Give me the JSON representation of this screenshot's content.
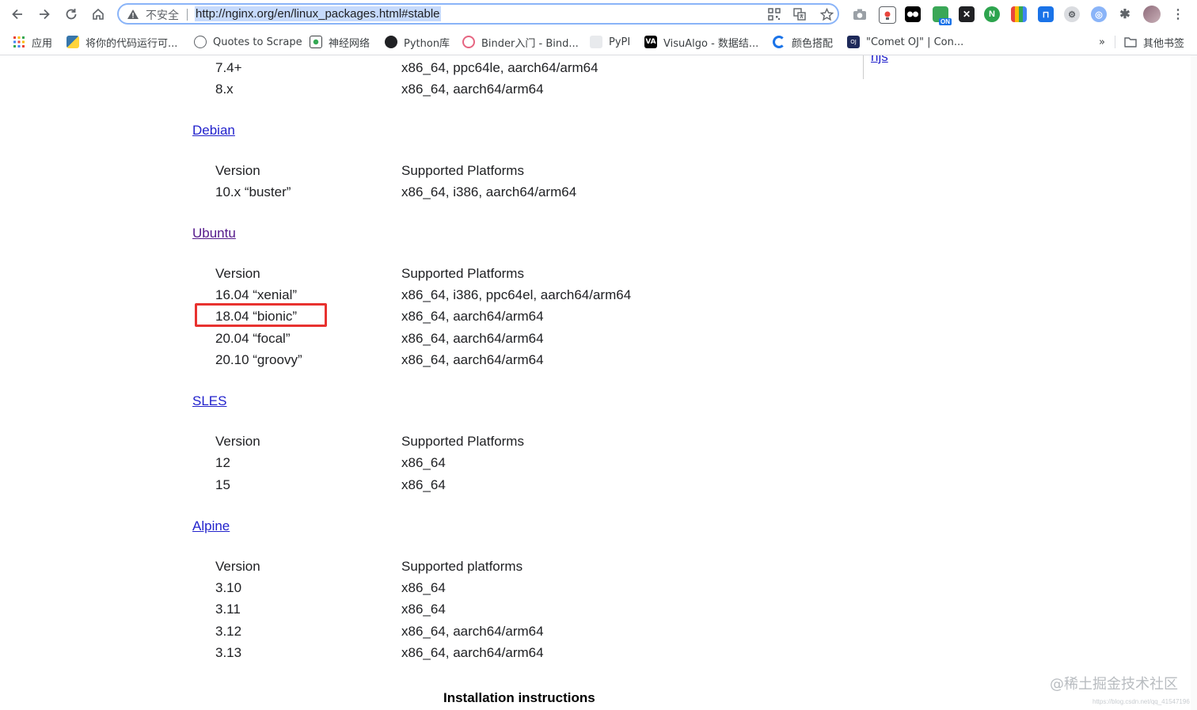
{
  "browser": {
    "insecure_label": "不安全",
    "url": "http://nginx.org/en/linux_packages.html#stable"
  },
  "bookmarks": [
    {
      "label": "应用"
    },
    {
      "label": "将你的代码运行可..."
    },
    {
      "label": "Quotes to Scrape"
    },
    {
      "label": "神经网络"
    },
    {
      "label": "Python库"
    },
    {
      "label": "Binder入门 - Bind..."
    },
    {
      "label": "PyPI"
    },
    {
      "label": "VisuAlgo - 数据结..."
    },
    {
      "label": "颜色搭配"
    },
    {
      "label": "\"Comet OJ\" | Con..."
    }
  ],
  "bookmarks_overflow": "»",
  "other_bookmarks": "其他书签",
  "sidebar": {
    "link": "njs"
  },
  "sections": {
    "top_rows": [
      {
        "version": "7.4+",
        "platforms": "x86_64, ppc64le, aarch64/arm64"
      },
      {
        "version": "8.x",
        "platforms": "x86_64, aarch64/arm64"
      }
    ],
    "debian": {
      "title": "Debian",
      "header": {
        "version": "Version",
        "platforms": "Supported Platforms"
      },
      "rows": [
        {
          "version": "10.x “buster”",
          "platforms": "x86_64, i386, aarch64/arm64"
        }
      ]
    },
    "ubuntu": {
      "title": "Ubuntu",
      "header": {
        "version": "Version",
        "platforms": "Supported Platforms"
      },
      "rows": [
        {
          "version": "16.04 “xenial”",
          "platforms": "x86_64, i386, ppc64el, aarch64/arm64"
        },
        {
          "version": "18.04 “bionic”",
          "platforms": "x86_64, aarch64/arm64"
        },
        {
          "version": "20.04 “focal”",
          "platforms": "x86_64, aarch64/arm64"
        },
        {
          "version": "20.10 “groovy”",
          "platforms": "x86_64, aarch64/arm64"
        }
      ]
    },
    "sles": {
      "title": "SLES",
      "header": {
        "version": "Version",
        "platforms": "Supported Platforms"
      },
      "rows": [
        {
          "version": "12",
          "platforms": "x86_64"
        },
        {
          "version": "15",
          "platforms": "x86_64"
        }
      ]
    },
    "alpine": {
      "title": "Alpine",
      "header": {
        "version": "Version",
        "platforms": "Supported platforms"
      },
      "rows": [
        {
          "version": "3.10",
          "platforms": "x86_64"
        },
        {
          "version": "3.11",
          "platforms": "x86_64"
        },
        {
          "version": "3.12",
          "platforms": "x86_64, aarch64/arm64"
        },
        {
          "version": "3.13",
          "platforms": "x86_64, aarch64/arm64"
        }
      ]
    }
  },
  "installation_title": "Installation instructions",
  "watermark": "@稀土掘金技术社区",
  "watermark_small": "https://blog.csdn.net/qq_41547196",
  "colors": {
    "link": "#2222cc",
    "visited_link": "#551a8b",
    "highlight_box": "#e8322f",
    "url_selection": "#c6dafc"
  }
}
